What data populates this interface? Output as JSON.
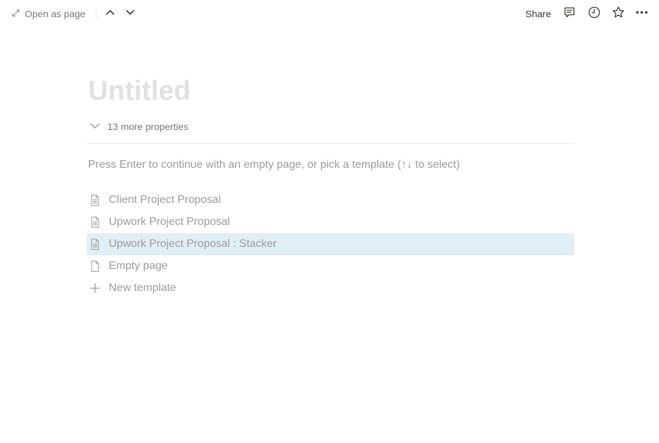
{
  "topbar": {
    "open_as_page_label": "Open as page",
    "share_label": "Share",
    "icons": [
      "expand-icon",
      "chevron-up-icon",
      "chevron-down-icon",
      "comment-icon",
      "history-icon",
      "star-icon",
      "more-icon"
    ]
  },
  "page": {
    "title_placeholder": "Untitled",
    "more_properties_label": "13 more properties",
    "template_hint": "Press Enter to continue with an empty page, or pick a template (↑↓ to select)"
  },
  "templates": [
    {
      "label": "Client Project Proposal",
      "icon": "document-icon",
      "selected": false
    },
    {
      "label": "Upwork Project Proposal",
      "icon": "document-icon",
      "selected": false
    },
    {
      "label": "Upwork Project Proposal : Stacker",
      "icon": "document-icon",
      "selected": true
    },
    {
      "label": "Empty page",
      "icon": "blank-page-icon",
      "selected": false
    },
    {
      "label": "New template",
      "icon": "plus-icon",
      "selected": false
    }
  ],
  "colors": {
    "selected_row": "#e0eff5",
    "muted_text": "#9b9a97",
    "placeholder_title": "#e1e1e0"
  }
}
